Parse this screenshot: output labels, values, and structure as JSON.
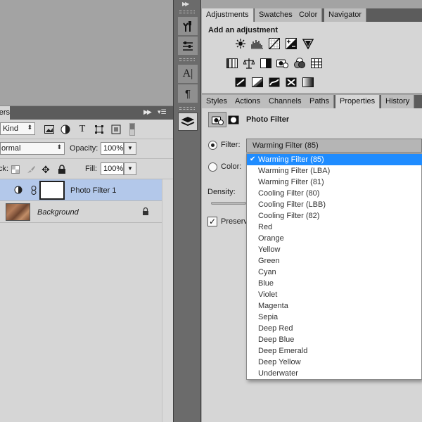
{
  "layers_panel": {
    "tab_label": "Layers",
    "kind_filter": "Kind",
    "blend_mode": "Normal",
    "opacity_label": "Opacity:",
    "opacity_value": "100%",
    "lock_label": "Lock:",
    "fill_label": "Fill:",
    "fill_value": "100%",
    "layers": [
      {
        "name": "Photo Filter 1",
        "selected": true
      },
      {
        "name": "Background",
        "selected": false
      }
    ]
  },
  "adjustments_panel": {
    "tabs": [
      "Adjustments",
      "Swatches",
      "Color",
      "Navigator"
    ],
    "active_tab": "Adjustments",
    "title": "Add an adjustment"
  },
  "properties_panel": {
    "tabs": [
      "Styles",
      "Actions",
      "Channels",
      "Paths",
      "Properties",
      "History"
    ],
    "active_tab": "Properties",
    "title": "Photo Filter",
    "filter_label": "Filter:",
    "filter_value": "Warming Filter (85)",
    "color_label": "Color:",
    "density_label": "Density:",
    "preserve_label": "Preserve Luminosity",
    "preserve_checked": true
  },
  "filter_dropdown": {
    "selected": "Warming Filter (85)",
    "options": [
      "Warming Filter (85)",
      "Warming Filter (LBA)",
      "Warming Filter (81)",
      "Cooling Filter (80)",
      "Cooling Filter (LBB)",
      "Cooling Filter (82)",
      "Red",
      "Orange",
      "Yellow",
      "Green",
      "Cyan",
      "Blue",
      "Violet",
      "Magenta",
      "Sepia",
      "Deep Red",
      "Deep Blue",
      "Deep Emerald",
      "Deep Yellow",
      "Underwater"
    ]
  },
  "colors": {
    "selection_blue": "#1f8cff",
    "layer_selected": "#b3c8ea",
    "panel_gray": "#d6d6d6",
    "tabbar_dark": "#5c5c5c"
  }
}
